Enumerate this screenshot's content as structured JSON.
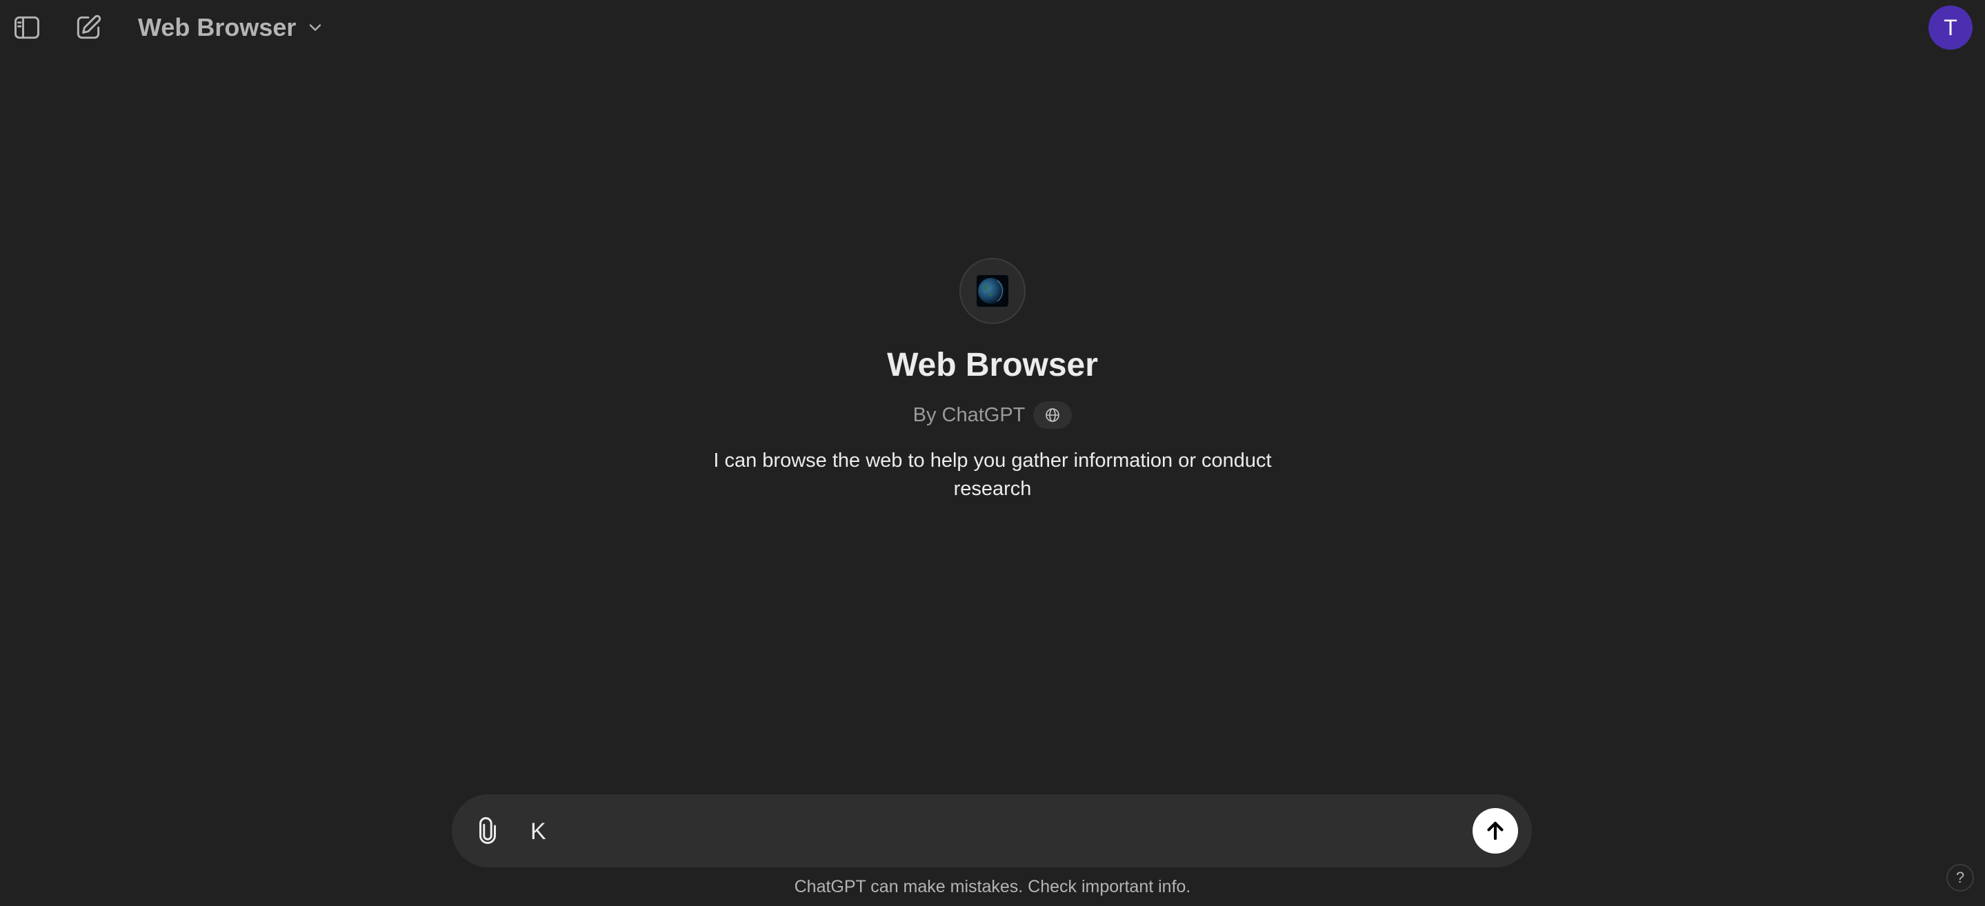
{
  "header": {
    "model_name": "Web Browser",
    "avatar_initial": "T",
    "sidebar_icon": "sidebar-toggle-icon",
    "new_chat_icon": "new-chat-icon",
    "dropdown_icon": "chevron-down-icon"
  },
  "gpt": {
    "title": "Web Browser",
    "byline": "By ChatGPT",
    "description": "I can browse the web to help you gather information or conduct research",
    "capability_icon": "globe-icon",
    "logo_icon": "earth-icon"
  },
  "composer": {
    "value": "K",
    "attach_icon": "paperclip-icon",
    "send_icon": "arrow-up-icon"
  },
  "footer": {
    "disclaimer": "ChatGPT can make mistakes. Check important info.",
    "help_label": "?"
  },
  "colors": {
    "background": "#212121",
    "composer": "#2f2f2f",
    "avatar": "#4b2fb0",
    "send_button": "#ffffff"
  }
}
